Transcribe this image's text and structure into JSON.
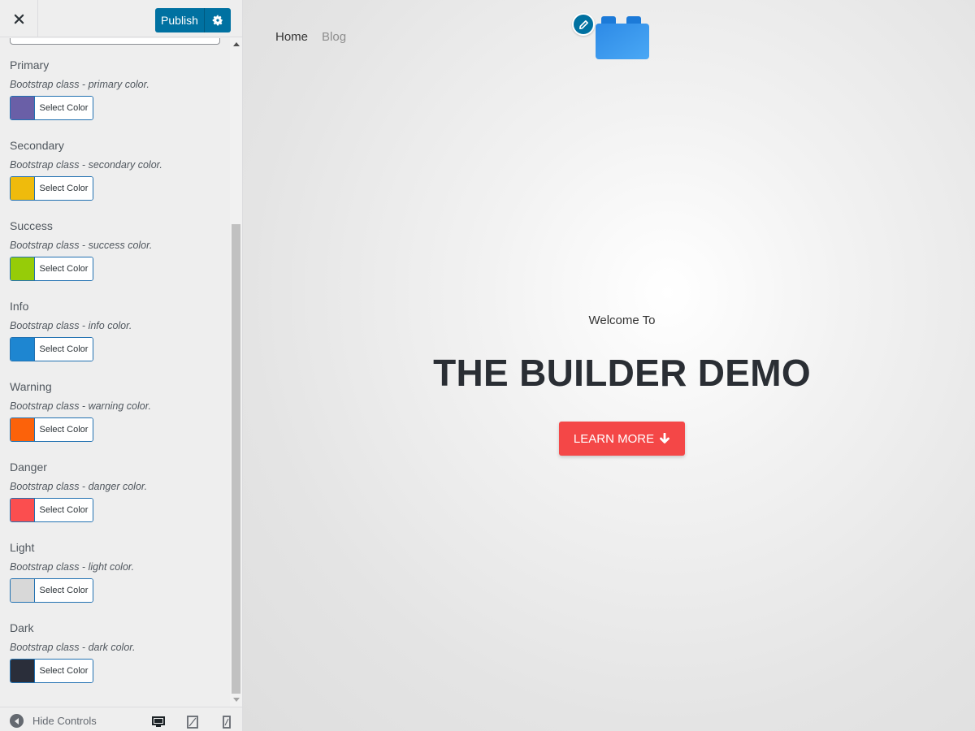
{
  "topbar": {
    "publish_label": "Publish"
  },
  "colors": [
    {
      "label": "Primary",
      "desc": "Bootstrap class - primary color.",
      "swatch": "#6a5fa7",
      "button": "Select Color"
    },
    {
      "label": "Secondary",
      "desc": "Bootstrap class - secondary color.",
      "swatch": "#efbb0c",
      "button": "Select Color"
    },
    {
      "label": "Success",
      "desc": "Bootstrap class - success color.",
      "swatch": "#96cc08",
      "button": "Select Color"
    },
    {
      "label": "Info",
      "desc": "Bootstrap class - info color.",
      "swatch": "#1e86d1",
      "button": "Select Color"
    },
    {
      "label": "Warning",
      "desc": "Bootstrap class - warning color.",
      "swatch": "#fc620a",
      "button": "Select Color"
    },
    {
      "label": "Danger",
      "desc": "Bootstrap class - danger color.",
      "swatch": "#fb4e4f",
      "button": "Select Color"
    },
    {
      "label": "Light",
      "desc": "Bootstrap class - light color.",
      "swatch": "#d8d8d8",
      "button": "Select Color"
    },
    {
      "label": "Dark",
      "desc": "Bootstrap class - dark color.",
      "swatch": "#2a2e3a",
      "button": "Select Color"
    }
  ],
  "footer": {
    "hide_controls": "Hide Controls"
  },
  "preview": {
    "nav": {
      "home": "Home",
      "blog": "Blog"
    },
    "welcome": "Welcome To",
    "title": "THE BUILDER DEMO",
    "cta": "LEARN MORE"
  }
}
